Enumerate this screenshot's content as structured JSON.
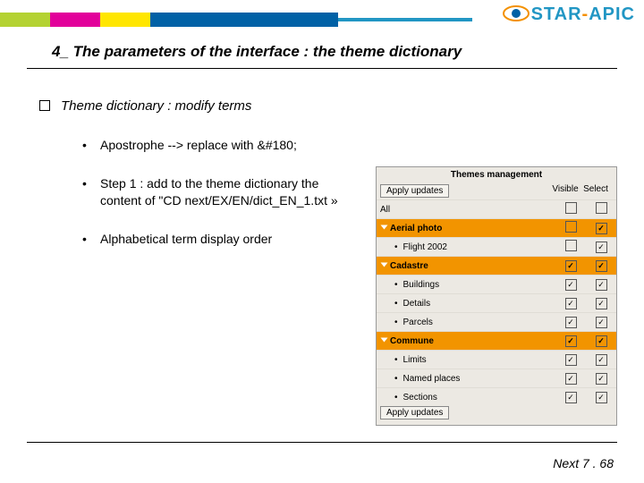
{
  "brand": {
    "name": "STAR",
    "dash": "-",
    "suffix": "APIC"
  },
  "title": "4_ The parameters of the interface : the theme dictionary",
  "heading": "Theme dictionary : modify terms",
  "bullets": [
    "Apostrophe --> replace with &#180;",
    "Step 1 : add to the theme dictionary the content of \"CD next/EX/EN/dict_EN_1.txt »",
    "Alphabetical term display order"
  ],
  "shot": {
    "title": "Themes management",
    "apply": "Apply updates",
    "cols": {
      "visible": "Visible",
      "select": "Select"
    },
    "all": "All",
    "groups": [
      {
        "name": "Aerial photo",
        "vis": "",
        "sel": "✓",
        "items": [
          {
            "name": "Flight 2002",
            "vis": "",
            "sel": "✓"
          }
        ]
      },
      {
        "name": "Cadastre",
        "vis": "✓",
        "sel": "✓",
        "items": [
          {
            "name": "Buildings",
            "vis": "✓",
            "sel": "✓"
          },
          {
            "name": "Details",
            "vis": "✓",
            "sel": "✓"
          },
          {
            "name": "Parcels",
            "vis": "✓",
            "sel": "✓"
          }
        ]
      },
      {
        "name": "Commune",
        "vis": "✓",
        "sel": "✓",
        "items": [
          {
            "name": "Limits",
            "vis": "✓",
            "sel": "✓"
          },
          {
            "name": "Named places",
            "vis": "✓",
            "sel": "✓"
          },
          {
            "name": "Sections",
            "vis": "✓",
            "sel": "✓"
          }
        ]
      }
    ]
  },
  "footer": "Next 7 . 68"
}
